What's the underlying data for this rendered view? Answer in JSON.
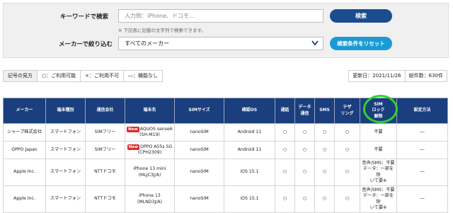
{
  "search": {
    "keyword_label": "キーワードで検索",
    "keyword_placeholder": "入力例：iPhone、ドコモ…",
    "note": "※ 下記表に記載の文字列で検索できます。",
    "maker_label": "メーカーで絞り込む",
    "maker_selected": "すべてのメーカー",
    "search_button": "検索",
    "reset_button": "検索条件をリセット"
  },
  "legend": {
    "title": "記号の見方",
    "available": "○：ご利用可能",
    "unavailable": "×：ご利用不可",
    "none": "―：機能なし"
  },
  "info": {
    "updated": "更新日：2021/11/26",
    "total": "総件数：630件"
  },
  "table": {
    "headers": {
      "maker": "メーカー",
      "type": "端末種別",
      "carrier": "通信会社",
      "model": "端末名",
      "sim_size": "SIMサイズ",
      "os": "確認OS",
      "call": "通話",
      "data_line1": "データ",
      "data_line2": "通信",
      "sms": "SMS",
      "tethering_line1": "テザ",
      "tethering_line2": "リング",
      "simlock_line1": "SIM",
      "simlock_line2": "ロック",
      "simlock_line3": "解除",
      "setup": "設定方法"
    },
    "rows": [
      {
        "maker": "シャープ株式会社",
        "type": "スマートフォン",
        "carrier": "SIMフリー",
        "badge": "New",
        "model_line1": "AQUOS sense6",
        "model_line2": "(SH-M19)",
        "sim": "nanoSIM",
        "os": "Android 11",
        "call": "○",
        "data": "○",
        "sms": "○",
        "tether": "○",
        "simlock_line1": "不要",
        "simlock_line2": "",
        "simlock_line3": "",
        "setup": "―"
      },
      {
        "maker": "OPPO Japan",
        "type": "スマートフォン",
        "carrier": "SIMフリー",
        "badge": "New",
        "model_line1": "OPPO A55s 5G",
        "model_line2": "(CPH2309)",
        "sim": "nanoSIM",
        "os": "Android 11",
        "call": "○",
        "data": "○",
        "sms": "○",
        "tether": "○",
        "simlock_line1": "不要",
        "simlock_line2": "",
        "simlock_line3": "",
        "setup": "―"
      },
      {
        "maker": "Apple Inc.",
        "type": "スマートフォン",
        "carrier": "NTTドコモ",
        "badge": "",
        "model_line1": "iPhone 13 mini",
        "model_line2": "(MLJC3J/A)",
        "sim": "nanoSIM",
        "os": "iOS 15.1",
        "call": "○",
        "data": "○",
        "sms": "○",
        "tether": "○",
        "simlock_line1": "音声/SMS：不要",
        "simlock_line2": "データ：一部を除",
        "simlock_line3": "いて要※",
        "setup": "―"
      },
      {
        "maker": "Apple Inc.",
        "type": "スマートフォン",
        "carrier": "NTTドコモ",
        "badge": "",
        "model_line1": "iPhone 13",
        "model_line2": "(MLND3J/A)",
        "sim": "nanoSIM",
        "os": "iOS 15.1",
        "call": "○",
        "data": "○",
        "sms": "○",
        "tether": "○",
        "simlock_line1": "音声/SMS：不要",
        "simlock_line2": "データ：一部を除",
        "simlock_line3": "いて要※",
        "setup": "―"
      }
    ]
  },
  "colors": {
    "header_bg": "#1a3e7e",
    "search_btn": "#1a4c8f",
    "reset_btn": "#1a9bd5",
    "new_badge": "#e02b2b",
    "highlight": "#2fd22f"
  }
}
